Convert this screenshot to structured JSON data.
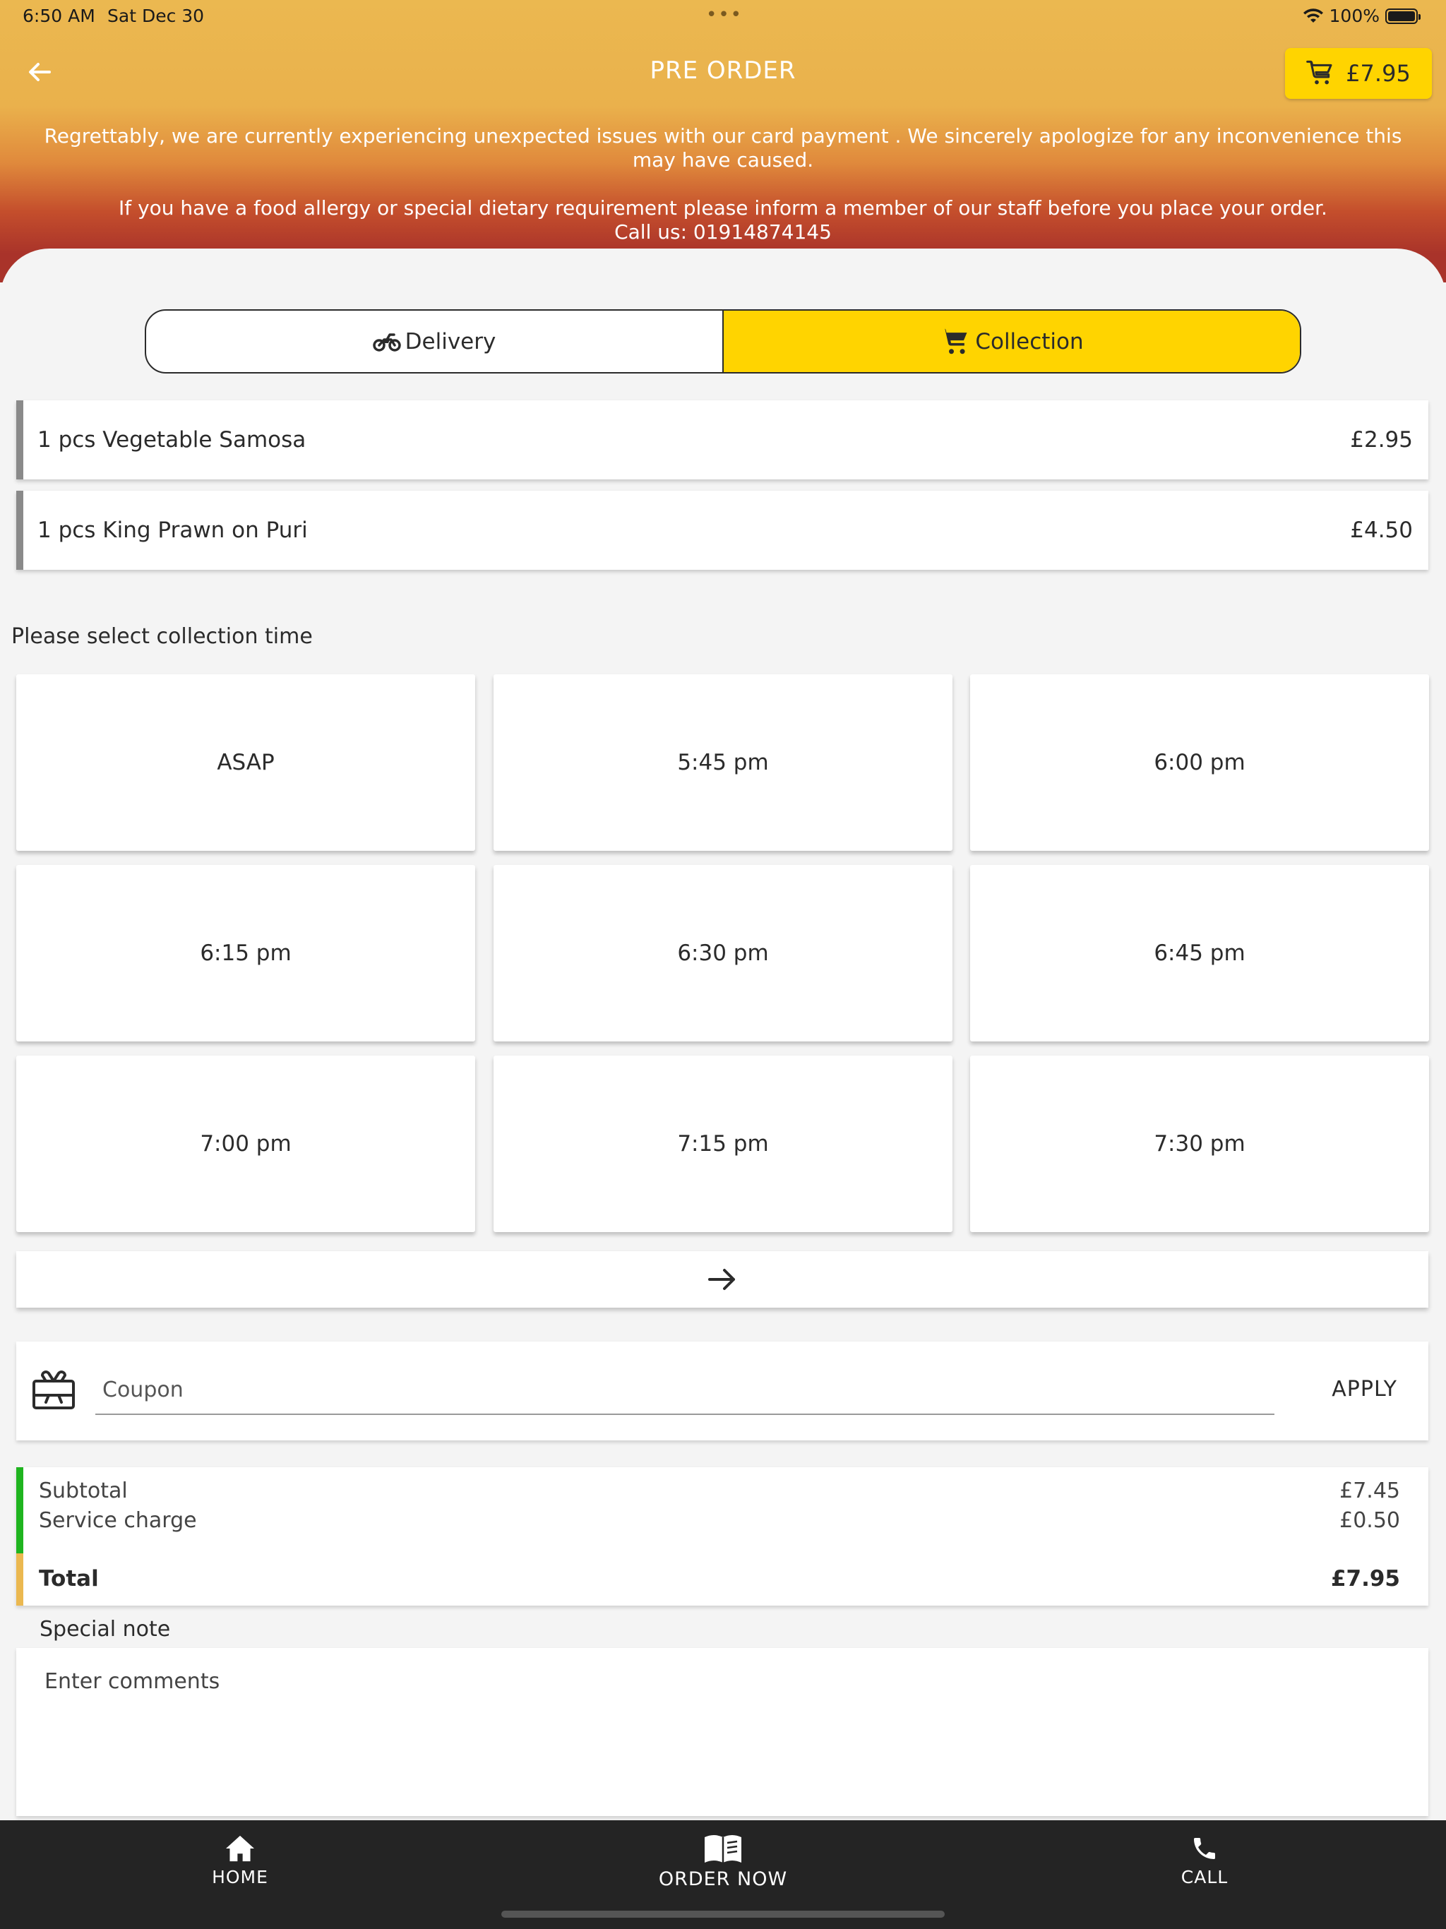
{
  "status_bar": {
    "time": "6:50 AM",
    "date": "Sat Dec 30",
    "dots": "•••",
    "battery": "100%"
  },
  "header": {
    "title": "PRE ORDER",
    "cart_total": "£7.95",
    "notice_1": "Regrettably, we are currently experiencing unexpected issues with our card payment . We sincerely apologize for any inconvenience this may have caused.",
    "notice_2": "If you have a food allergy or special dietary requirement please inform a member of our staff before you place your order.",
    "notice_3": "Call us: 01914874145"
  },
  "order_type": {
    "delivery_label": "Delivery",
    "collection_label": "Collection",
    "selected": "Collection"
  },
  "items": [
    {
      "name": "1 pcs Vegetable Samosa",
      "price": "£2.95"
    },
    {
      "name": "1 pcs King Prawn on Puri",
      "price": "£4.50"
    }
  ],
  "collection": {
    "label": "Please select collection time",
    "slots": [
      "ASAP",
      "5:45 pm",
      "6:00 pm",
      "6:15 pm",
      "6:30 pm",
      "6:45 pm",
      "7:00 pm",
      "7:15 pm",
      "7:30 pm"
    ]
  },
  "coupon": {
    "placeholder": "Coupon",
    "apply_label": "APPLY"
  },
  "totals": {
    "subtotal_label": "Subtotal",
    "subtotal_value": "£7.45",
    "service_label": "Service charge",
    "service_value": "£0.50",
    "total_label": "Total",
    "total_value": "£7.95"
  },
  "note": {
    "label": "Special note",
    "placeholder": "Enter comments"
  },
  "nav": {
    "home": "HOME",
    "order_now": "ORDER NOW",
    "call": "CALL"
  },
  "colors": {
    "accent_yellow": "#ffd400",
    "header_top": "#ebb850",
    "header_bottom": "#a9332a",
    "subtotal_bar": "#1fb41f",
    "total_bar": "#ebb850",
    "nav_bg": "#242424"
  }
}
